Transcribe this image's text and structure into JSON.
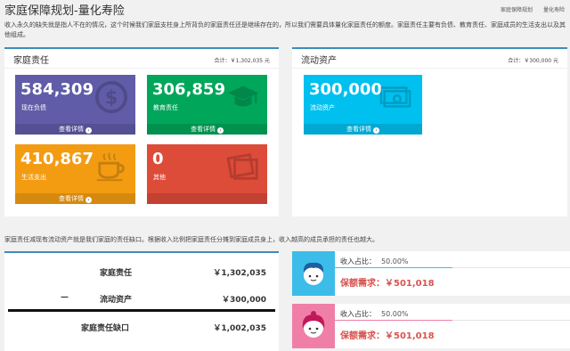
{
  "header": {
    "title": "家庭保障规划-量化寿险",
    "breadcrumb": [
      "家庭保障规划",
      "量化寿险"
    ]
  },
  "intro": "收入永久的缺失就是指人不在的情况，这个时候我们家庭支柱身上所背负的家庭责任还是继续存在的，所以我们需要具体量化家庭责任的额度。家庭责任主要有负债、教育责任、家庭成员的生活支出以及其他组成。",
  "family": {
    "title": "家庭责任",
    "total": "合计：￥1,302,035 元",
    "tiles": [
      {
        "value": "584,309",
        "label": "现在负债",
        "footer": "查看详情",
        "color": "#605ca8",
        "icon": "dollar-coin-icon"
      },
      {
        "value": "306,859",
        "label": "教育责任",
        "footer": "查看详情",
        "color": "#00a65a",
        "icon": "graduation-cap-icon"
      },
      {
        "value": "410,867",
        "label": "生活支出",
        "footer": "查看详情",
        "color": "#f39c12",
        "icon": "coffee-cup-icon"
      },
      {
        "value": "0",
        "label": "其他",
        "footer": "",
        "color": "#dd4b39",
        "icon": "photos-icon"
      }
    ]
  },
  "liquid": {
    "title": "流动资产",
    "total": "合计：￥300,000 元",
    "tile": {
      "value": "300,000",
      "label": "流动资产",
      "footer": "查看详情",
      "color": "#00c0ef",
      "icon": "money-stack-icon"
    }
  },
  "gap_note": "家庭责任减现有流动资产就是我们家庭的责任缺口。根据收入比例把家庭责任分摊到家庭成员身上，收入越高的成员承担的责任也越大。",
  "gap": {
    "rows": [
      {
        "label": "家庭责任",
        "value": "￥1,302,035"
      },
      {
        "label": "流动资产",
        "value": "￥300,000",
        "sign": "—"
      },
      {
        "label": "家庭责任缺口",
        "value": "￥1,002,035"
      }
    ]
  },
  "persons": [
    {
      "ratio_label": "收入占比：",
      "ratio_value": "50.00%",
      "ratio": 0.5,
      "need": "保额需求：￥501,018",
      "color": "#3cbde9",
      "icon": "boy-avatar-icon"
    },
    {
      "ratio_label": "收入占比：",
      "ratio_value": "50.00%",
      "ratio": 0.5,
      "need": "保额需求：￥501,018",
      "color": "#f07fa8",
      "icon": "girl-avatar-icon"
    }
  ]
}
